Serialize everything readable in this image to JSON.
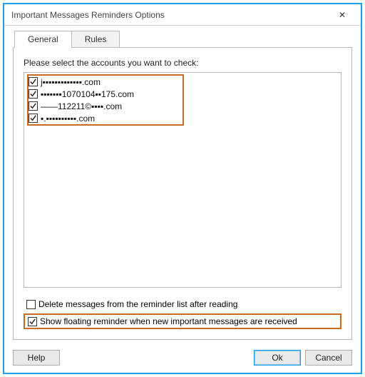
{
  "window": {
    "title": "Important Messages Reminders Options",
    "close_glyph": "✕"
  },
  "tabs": {
    "general": "General",
    "rules": "Rules"
  },
  "general_panel": {
    "prompt": "Please select the accounts you want to check:",
    "accounts": [
      {
        "checked": true,
        "label": "j▪▪▪▪▪▪▪▪▪▪▪▪▪.com"
      },
      {
        "checked": true,
        "label": "▪▪▪▪▪▪▪1070104▪▪175.com"
      },
      {
        "checked": true,
        "label": "——112211©▪▪▪▪.com"
      },
      {
        "checked": true,
        "label": "▪.▪▪▪▪▪▪▪▪▪▪.com"
      }
    ],
    "delete_option": {
      "checked": false,
      "label": "Delete messages from the reminder list after reading"
    },
    "floating_option": {
      "checked": true,
      "label": "Show floating reminder when new important messages are received"
    }
  },
  "buttons": {
    "help": "Help",
    "ok": "Ok",
    "cancel": "Cancel"
  }
}
